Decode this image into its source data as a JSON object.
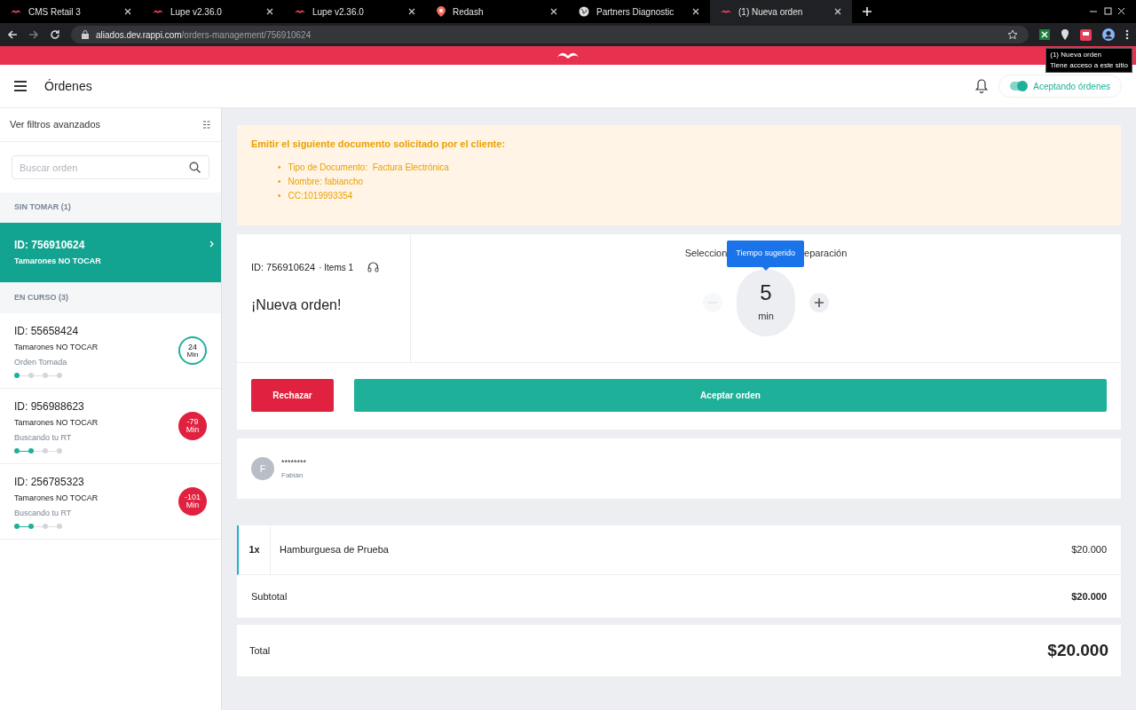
{
  "browser": {
    "tabs": [
      {
        "title": "CMS Retail 3",
        "kind": "mustache",
        "selected": false
      },
      {
        "title": "Lupe v2.36.0",
        "kind": "mustache",
        "selected": false
      },
      {
        "title": "Lupe v2.36.0",
        "kind": "mustache",
        "selected": false
      },
      {
        "title": "Redash",
        "kind": "pin",
        "selected": false
      },
      {
        "title": "Partners Diagnostic",
        "kind": "globe",
        "selected": false
      },
      {
        "title": "(1) Nueva orden",
        "kind": "mustache",
        "selected": true
      }
    ],
    "url_host": "aliados.dev.rappi.com",
    "url_path": "/orders-management/756910624",
    "extension_tooltip": {
      "title": "(1) Nueva orden",
      "subtitle": "Tiene acceso a este sitio"
    }
  },
  "header": {
    "title": "Órdenes",
    "toggle": {
      "label": "Aceptando órdenes",
      "on": true
    }
  },
  "sidebar": {
    "filters_label": "Ver filtros avanzados",
    "search": {
      "placeholder": "Buscar orden"
    },
    "sections": [
      {
        "title": "SIN TOMAR (1)",
        "orders": [
          {
            "id": "ID: 756910624",
            "store": "Tamarones NO TOCAR",
            "selected": true
          }
        ]
      },
      {
        "title": "EN CURSO (3)",
        "orders": [
          {
            "id": "ID: 55658424",
            "store": "Tamarones NO TOCAR",
            "status": "Orden Tomada",
            "selected": false,
            "steps": [
              true,
              false,
              false,
              false
            ],
            "timer": {
              "kind": "ring",
              "value": "24",
              "unit": "Min"
            }
          },
          {
            "id": "ID: 956988623",
            "store": "Tamarones NO TOCAR",
            "status": "Buscando tu RT",
            "selected": false,
            "steps": [
              true,
              true,
              false,
              false
            ],
            "timer": {
              "kind": "late",
              "value": "-79",
              "unit": "Min"
            }
          },
          {
            "id": "ID: 256785323",
            "store": "Tamarones NO TOCAR",
            "status": "Buscando tu RT",
            "selected": false,
            "steps": [
              true,
              true,
              false,
              false
            ],
            "timer": {
              "kind": "late",
              "value": "-101",
              "unit": "Min"
            }
          }
        ]
      }
    ]
  },
  "notice": {
    "title": "Emitir el siguiente documento solicitado por el cliente:",
    "items": [
      {
        "marker": "•",
        "text": "Tipo de Documento:  Factura Electrónica"
      },
      {
        "marker": "•",
        "text": "Nombre: fabiancho"
      },
      {
        "marker": "•",
        "text": "CC:1019993354"
      }
    ]
  },
  "order": {
    "id": "ID: 756910624",
    "items": "· Items 1",
    "headline": "¡Nueva orden!",
    "prep": {
      "label_start": "Seleccion",
      "label_end": "eparación",
      "tooltip": "Tiempo sugerido",
      "value": "5",
      "unit": "min",
      "minus_disabled": true
    },
    "reject": "Rechazar",
    "accept": "Aceptar orden"
  },
  "customer": {
    "initial": "F",
    "masked": "********",
    "name": "Fabián"
  },
  "lines": [
    {
      "qty": "1x",
      "name": "Hamburguesa de Prueba",
      "price": "$20.000"
    }
  ],
  "subtotal": {
    "label": "Subtotal",
    "value": "$20.000"
  },
  "total": {
    "label": "Total",
    "value": "$20.000"
  }
}
